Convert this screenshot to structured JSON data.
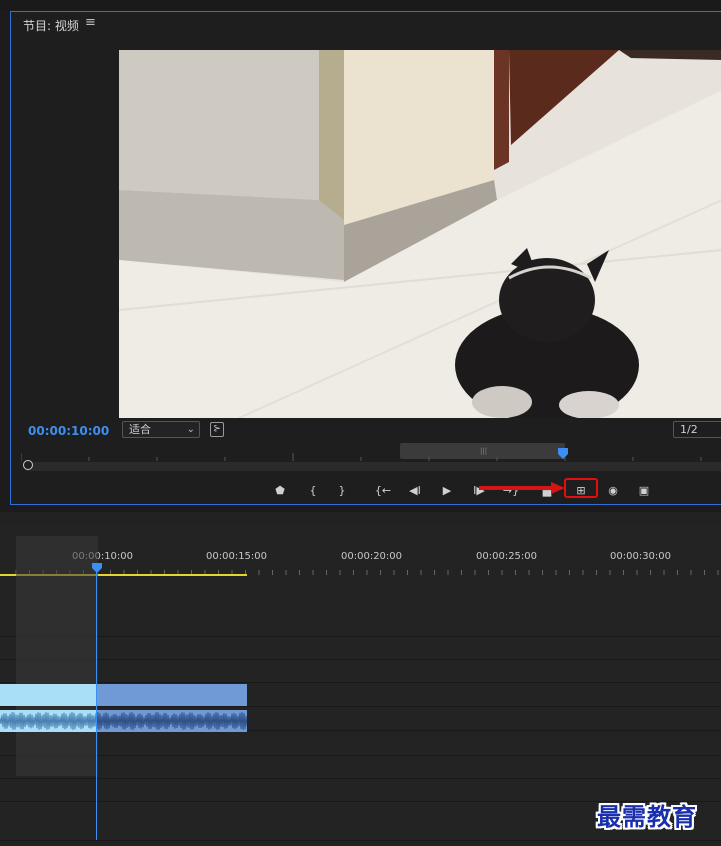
{
  "monitor": {
    "title": "节目: 视频",
    "menu_glyph": "≡",
    "timecode": "00:00:10:00",
    "fit_label": "适合",
    "resolution": "1/2",
    "controls": [
      {
        "name": "add-marker",
        "glyph": "⬟"
      },
      {
        "name": "mark-in",
        "glyph": "{"
      },
      {
        "name": "mark-out",
        "glyph": "}"
      },
      {
        "name": "go-to-in",
        "glyph": "{←"
      },
      {
        "name": "step-back",
        "glyph": "◀I"
      },
      {
        "name": "play",
        "glyph": "▶"
      },
      {
        "name": "step-forward",
        "glyph": "I▶"
      },
      {
        "name": "go-to-out",
        "glyph": "→}"
      },
      {
        "name": "extract",
        "glyph": "▄"
      },
      {
        "name": "lift",
        "glyph": "⊞"
      },
      {
        "name": "export-frame",
        "glyph": "◉"
      },
      {
        "name": "button-editor",
        "glyph": "▣"
      }
    ],
    "accent_color": "#3f8ff0",
    "highlight_color": "#e01010"
  },
  "timeline": {
    "timecodes": [
      "00:00:10:00",
      "00:00:15:00",
      "00:00:20:00",
      "00:00:25:00",
      "00:00:30:00"
    ],
    "playhead_color": "#3a8ff0",
    "clip_color": "#6f9ad6",
    "selected_clip_color": "#a9e0f7"
  },
  "watermark": "最需教育"
}
